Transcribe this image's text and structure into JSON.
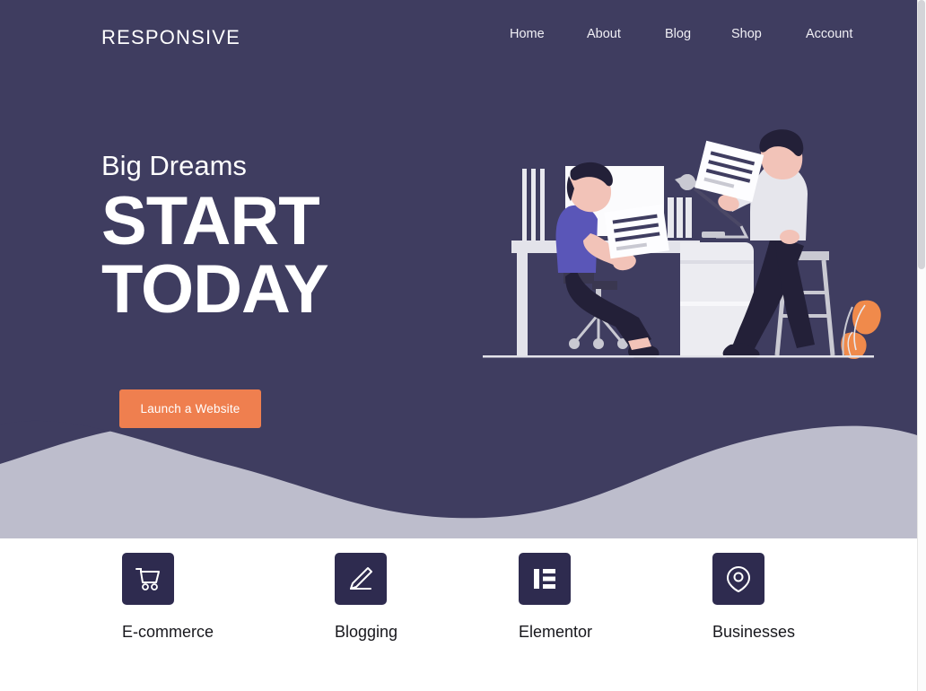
{
  "brand": {
    "logo_text": "RESPONSIVE",
    "navy": "#3f3d60",
    "navy_dark": "#2e2b4f",
    "orange": "#ef7f4f",
    "wave_light": "#bdbdcc",
    "white": "#ffffff"
  },
  "nav": {
    "items": [
      {
        "label": "Home",
        "icon": "nav-home"
      },
      {
        "label": "About",
        "icon": "nav-about"
      },
      {
        "label": "Blog",
        "icon": "nav-blog"
      },
      {
        "label": "Shop",
        "icon": "nav-shop"
      },
      {
        "label": "Account",
        "icon": "nav-account"
      }
    ]
  },
  "hero": {
    "eyebrow": "Big Dreams",
    "headline_line1": "START",
    "headline_line2": "TODAY",
    "cta_label": "Launch a Website",
    "illustration_name": "two-people-at-desk-illustration"
  },
  "features": [
    {
      "label": "E-commerce",
      "icon": "shopping-cart-icon"
    },
    {
      "label": "Blogging",
      "icon": "pencil-icon"
    },
    {
      "label": "Elementor",
      "icon": "elementor-logo-icon"
    },
    {
      "label": "Businesses",
      "icon": "map-pin-icon"
    }
  ]
}
